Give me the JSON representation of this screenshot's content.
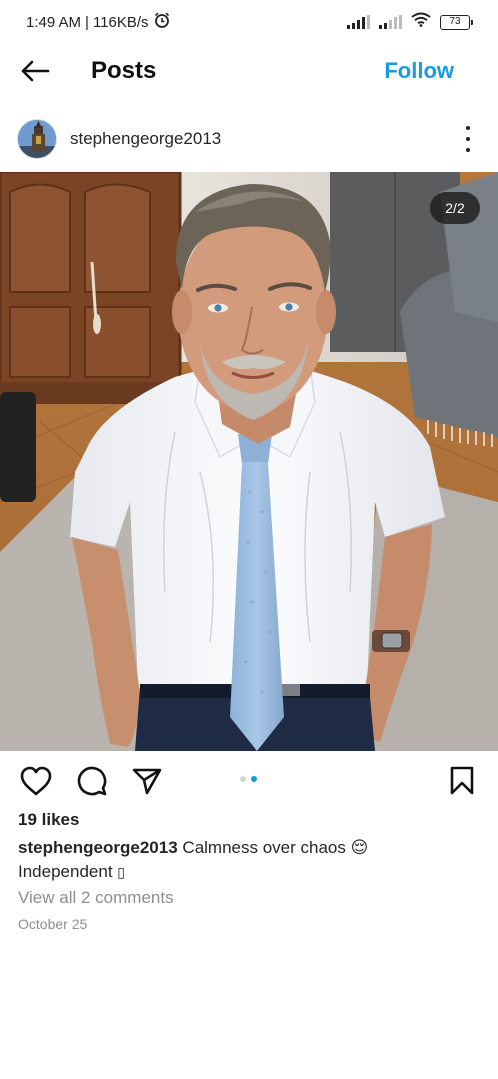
{
  "status_bar": {
    "time": "1:49 AM",
    "speed": "116KB/s",
    "battery": "73",
    "icons": [
      "alarm-icon",
      "signal-icon",
      "signal-icon",
      "wifi-icon",
      "battery-icon"
    ]
  },
  "header": {
    "title": "Posts",
    "follow_label": "Follow",
    "back_icon": "arrow-left-icon"
  },
  "post": {
    "username": "stephengeorge2013",
    "counter": "2/2",
    "carousel": {
      "total": 2,
      "active": 2
    },
    "likes": "19 likes",
    "caption_user": "stephengeorge2013",
    "caption_text": "Calmness over chaos 😌",
    "caption_line2": "Independent ",
    "caption_glyph": "▯",
    "comments_link": "View all 2 comments",
    "date": "October 25",
    "actions": [
      "heart-icon",
      "comment-icon",
      "share-icon",
      "bookmark-icon"
    ]
  },
  "colors": {
    "accent": "#1a9ae3",
    "text": "#262626",
    "muted": "#8e8e8e"
  }
}
